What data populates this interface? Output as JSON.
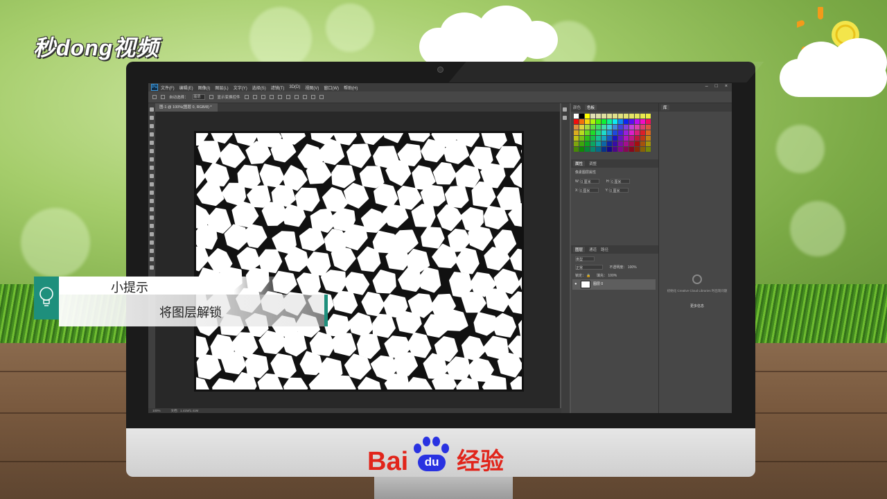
{
  "logo": {
    "text": "秒dong视频"
  },
  "photoshop": {
    "menu": [
      "文件(F)",
      "编辑(E)",
      "图像(I)",
      "图层(L)",
      "文字(Y)",
      "选择(S)",
      "滤镜(T)",
      "3D(D)",
      "视图(V)",
      "窗口(W)",
      "帮助(H)"
    ],
    "options": {
      "auto_select_label": "自动选择：",
      "auto_select_value": "图层",
      "transform_label": "显示变换控件"
    },
    "document_tab": "图-1 @ 100%(图层 0, RGB/8) *",
    "status": {
      "zoom": "100%",
      "doc": "文档：1.41M/1.41M"
    },
    "color_panel": {
      "tabs": [
        "颜色",
        "色板"
      ]
    },
    "properties_panel": {
      "tabs": [
        "属性",
        "调整"
      ],
      "title": "像素图层属性",
      "w_label": "W:",
      "w_value": "0 厘米",
      "h_label": "H:",
      "h_value": "0 厘米",
      "x_label": "X:",
      "x_value": "0 厘米",
      "y_label": "Y:",
      "y_value": "0 厘米"
    },
    "layers_panel": {
      "tabs": [
        "图层",
        "通道",
        "路径"
      ],
      "kind": "类型",
      "blend_mode": "正常",
      "opacity_label": "不透明度：",
      "opacity_value": "100%",
      "lock_label": "锁定：",
      "fill_label": "填充：",
      "fill_value": "100%",
      "layer_name": "图层 0"
    },
    "library_panel": {
      "tab": "库",
      "message": "初始化 Creative Cloud Libraries 时出现问题",
      "link": "更多信息"
    }
  },
  "tip": {
    "title": "小提示",
    "body": "将图层解锁"
  },
  "brand": {
    "bai": "Bai",
    "du": "du",
    "jingyan": "经验"
  },
  "colors": {
    "baidu_red": "#e1251b",
    "baidu_blue": "#2932e1",
    "tip_teal": "#1e8f7c"
  }
}
